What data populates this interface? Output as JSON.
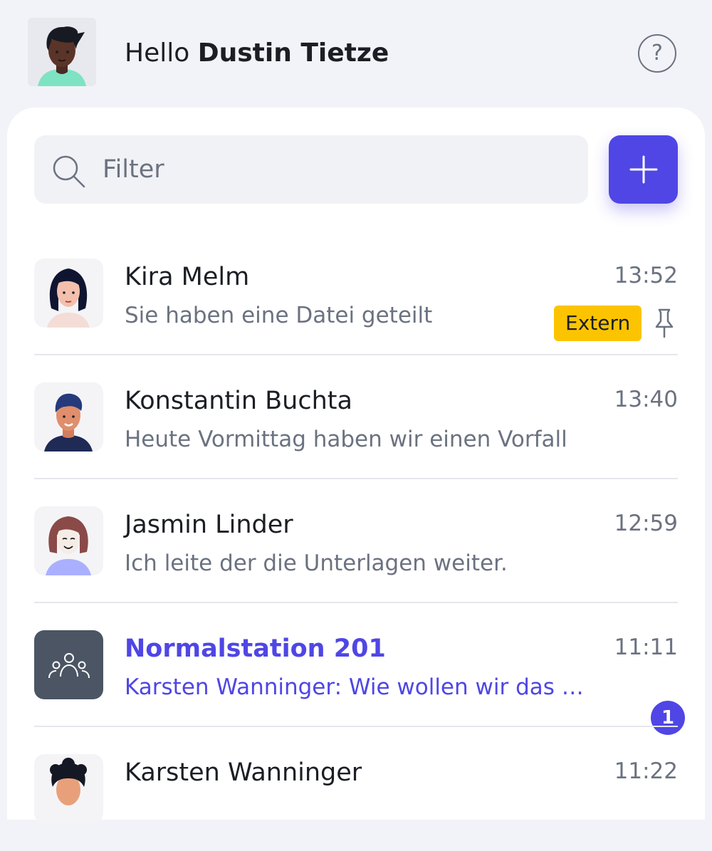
{
  "header": {
    "greeting": "Hello",
    "user_name": "Dustin Tietze",
    "help_symbol": "?",
    "help_icon": "question-circle-icon",
    "avatar_icon": "user-avatar"
  },
  "search": {
    "placeholder": "Filter",
    "icon": "search-icon"
  },
  "add_button": {
    "icon": "plus-icon"
  },
  "colors": {
    "accent": "#4f46e5",
    "extern_badge": "#fcc400",
    "muted_text": "#6b7280",
    "background": "#f2f3f8"
  },
  "conversations": [
    {
      "name": "Kira Melm",
      "time": "13:52",
      "preview": "Sie haben eine Datei geteilt",
      "badge": "Extern",
      "pinned": true
    },
    {
      "name": "Konstantin Buchta",
      "time": "13:40",
      "preview": "Heute Vormittag haben wir einen Vorfall"
    },
    {
      "name": "Jasmin Linder",
      "time": "12:59",
      "preview": "Ich leite der die Unterlagen weiter."
    },
    {
      "name": "Normalstation 201",
      "time": "11:11",
      "preview": "Karsten Wanninger: Wie wollen wir das in...",
      "unread_count": "1",
      "group": true
    },
    {
      "name": "Karsten Wanninger",
      "time": "11:22",
      "preview": ""
    }
  ]
}
